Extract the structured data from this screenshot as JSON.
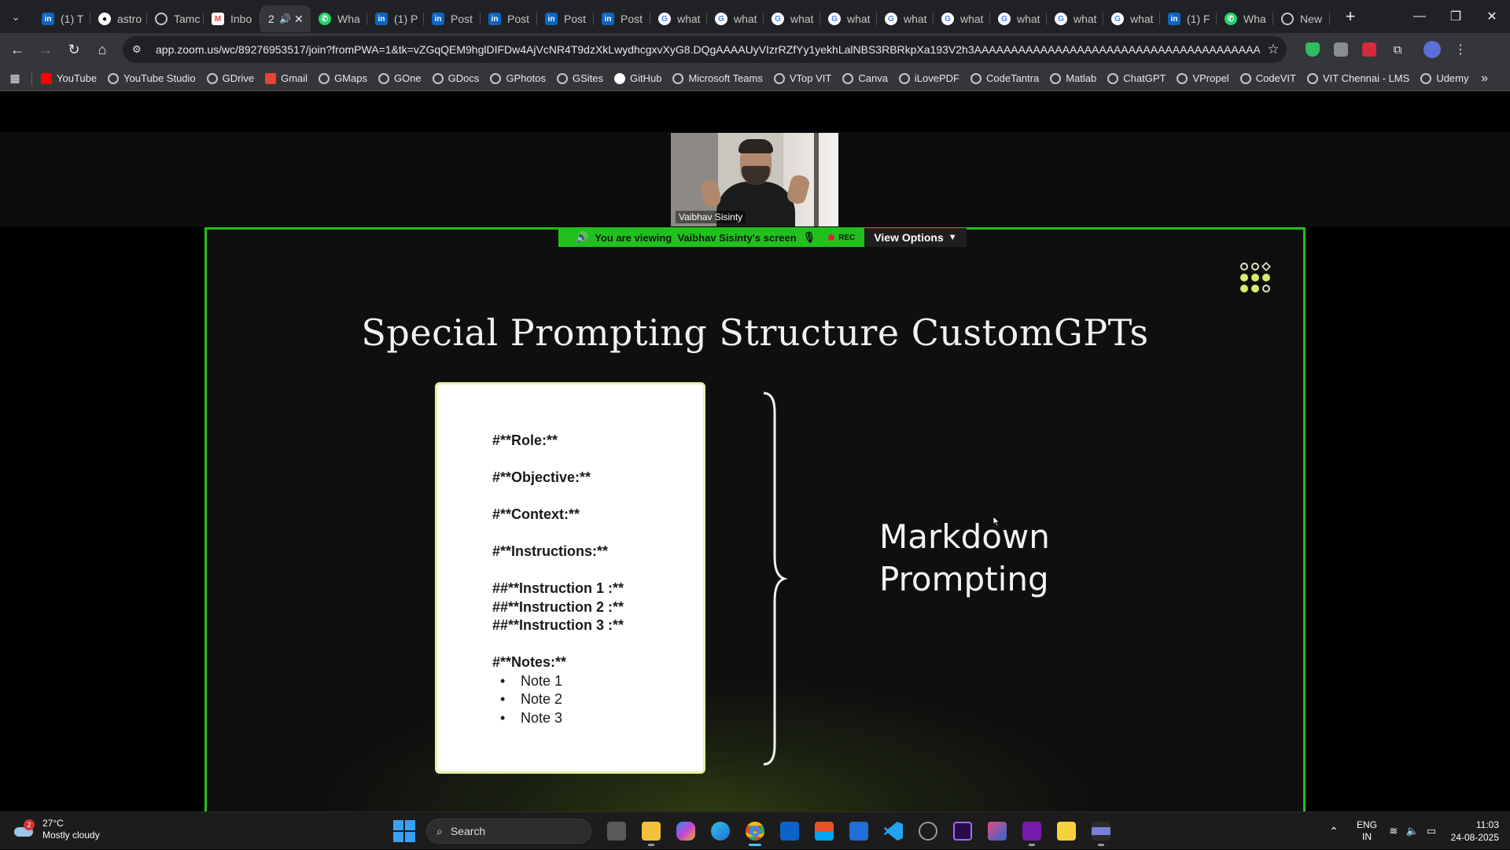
{
  "browser": {
    "tabs": [
      {
        "label": "(1) T",
        "icon": "linkedin-icon"
      },
      {
        "label": "astro",
        "icon": "github-icon"
      },
      {
        "label": "Tamc",
        "icon": "globe-icon"
      },
      {
        "label": "Inbo",
        "icon": "gmail-icon"
      },
      {
        "label": "2",
        "icon": "zoom-icon",
        "active": true
      },
      {
        "label": "Wha",
        "icon": "whatsapp-icon"
      },
      {
        "label": "(1) P",
        "icon": "linkedin-icon"
      },
      {
        "label": "Post",
        "icon": "linkedin-icon"
      },
      {
        "label": "Post",
        "icon": "linkedin-icon"
      },
      {
        "label": "Post",
        "icon": "linkedin-icon"
      },
      {
        "label": "Post",
        "icon": "linkedin-icon"
      },
      {
        "label": "what",
        "icon": "google-icon"
      },
      {
        "label": "what",
        "icon": "google-icon"
      },
      {
        "label": "what",
        "icon": "google-icon"
      },
      {
        "label": "what",
        "icon": "google-icon"
      },
      {
        "label": "what",
        "icon": "google-icon"
      },
      {
        "label": "what",
        "icon": "google-icon"
      },
      {
        "label": "what",
        "icon": "google-icon"
      },
      {
        "label": "what",
        "icon": "google-icon"
      },
      {
        "label": "what",
        "icon": "google-icon"
      },
      {
        "label": "(1) F",
        "icon": "linkedin-icon"
      },
      {
        "label": "Wha",
        "icon": "whatsapp-icon"
      },
      {
        "label": "New",
        "icon": "globe-icon"
      }
    ],
    "url": "app.zoom.us/wc/89276953517/join?fromPWA=1&tk=vZGqQEM9hglDIFDw4AjVcNR4T9dzXkLwydhcgxvXyG8.DQgAAAAUyVIzrRZfYy1yekhLalNBS3RBRkpXa193V2h3AAAAAAAAAAAAAAAAAAAAAAAAAAAAAAAAAAAAAAAAAA&_x_zm_r...",
    "bookmarks": [
      "YouTube",
      "YouTube Studio",
      "GDrive",
      "Gmail",
      "GMaps",
      "GOne",
      "GDocs",
      "GPhotos",
      "GSites",
      "GitHub",
      "Microsoft Teams",
      "VTop VIT",
      "Canva",
      "iLovePDF",
      "CodeTantra",
      "Matlab",
      "ChatGPT",
      "VPropel",
      "CodeVIT",
      "VIT Chennai - LMS",
      "Udemy"
    ]
  },
  "meeting": {
    "participant_name": "Vaibhav Sisinty",
    "viewing_prefix": "You are viewing",
    "viewing_name": "Vaibhav Sisinty's screen",
    "rec_label": "REC",
    "view_options_label": "View Options",
    "accent_color": "#22c01f"
  },
  "slide": {
    "title": "Special Prompting Structure CustomGPTs",
    "card_lines": [
      "#**Role:**",
      "#**Objective:**",
      "#**Context:**",
      "#**Instructions:**"
    ],
    "instruction_lines": [
      "##**Instruction 1 :**",
      "##**Instruction 2 :**",
      "##**Instruction 3 :**"
    ],
    "notes_heading": "#**Notes:**",
    "notes": [
      "Note 1",
      "Note 2",
      "Note 3"
    ],
    "side_title_line1": "Markdown",
    "side_title_line2": "Prompting"
  },
  "taskbar": {
    "weather_temp": "27°C",
    "weather_desc": "Mostly cloudy",
    "weather_badge": "2",
    "search_label": "Search",
    "lang_line1": "ENG",
    "lang_line2": "IN",
    "time": "11:03",
    "date": "24-08-2025"
  }
}
